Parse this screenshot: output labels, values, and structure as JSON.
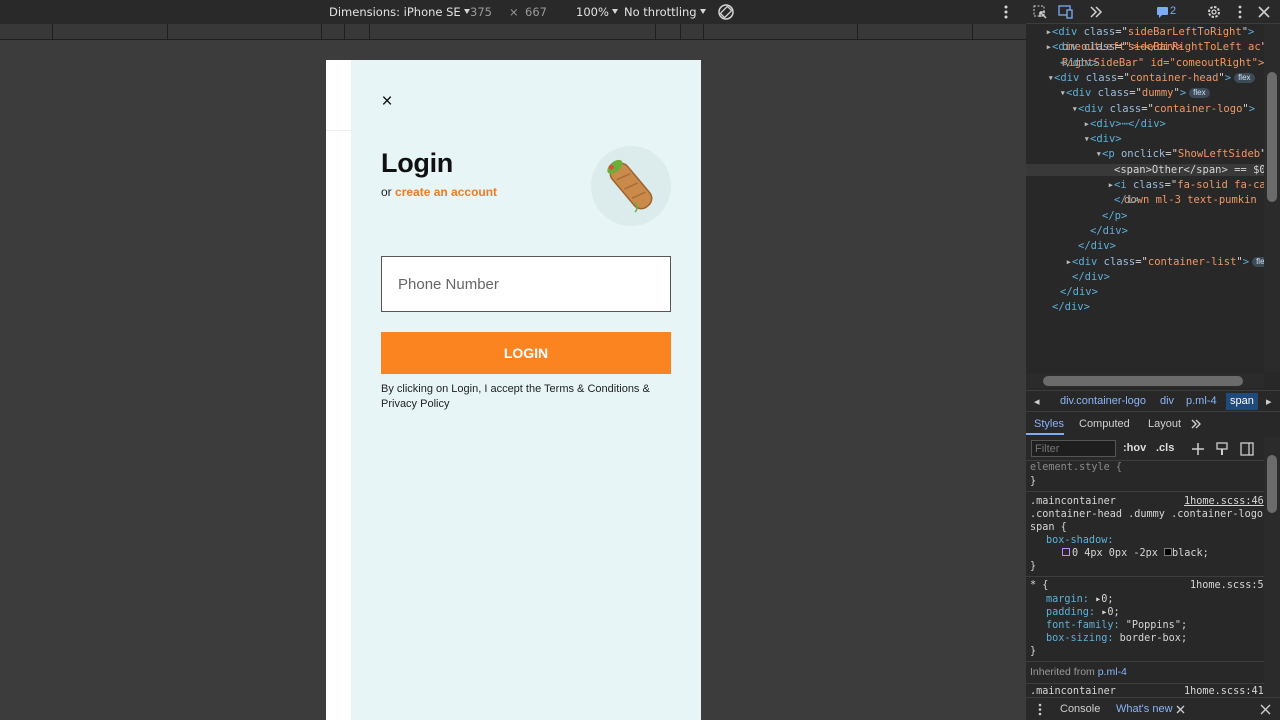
{
  "toolbar": {
    "dimensions_label": "Dimensions: iPhone SE",
    "width": "375",
    "times": "×",
    "height": "667",
    "zoom": "100%",
    "throttling": "No throttling"
  },
  "app": {
    "close_symbol": "×",
    "title": "Login",
    "subtitle_prefix": "or",
    "create_account": "create an account",
    "phone_placeholder": "Phone Number",
    "login_button": "LOGIN",
    "terms": "By clicking on Login, I accept the Terms & Conditions & Privacy Policy",
    "avatar_icon": "food-wrap-icon"
  },
  "devtools": {
    "issues_count": "2",
    "dom_lines": [
      {
        "tag": "div",
        "attr": "class",
        "val": "sideBarLeftToRight",
        "extra": "omeoutLeft\">⋯</div>"
      },
      {
        "tag": "div",
        "attr": "class",
        "val": "sideBarRightToLeft ac",
        "extra": "RightSideBar\" id=\"comeoutRight\">"
      },
      {
        "text": "</div>"
      },
      {
        "tag": "div",
        "attr": "class",
        "val": "container-head",
        "pill": "flex"
      },
      {
        "tag": "div",
        "attr": "class",
        "val": "dummy",
        "pill": "flex"
      },
      {
        "tag": "div",
        "attr": "class",
        "val": "container-logo"
      },
      {
        "text": "<div>⋯</div>"
      },
      {
        "text": "<div>"
      },
      {
        "tag": "p",
        "attr": "onclick",
        "val": "ShowLeftSideb",
        "extra": "\" class=\"ml-4\">"
      },
      {
        "text": "<span>Other</span> == $0"
      },
      {
        "tag": "i",
        "attr": "class",
        "val": "fa-solid fa-ca",
        "extra": "down ml-3 text-pumkin \">"
      },
      {
        "text": "</i>"
      },
      {
        "text": "</p>"
      },
      {
        "text": "</div>"
      },
      {
        "text": "</div>"
      },
      {
        "tag": "div",
        "attr": "class",
        "val": "container-list",
        "pill": "flex"
      },
      {
        "text": "</div>"
      },
      {
        "text": "</div>"
      },
      {
        "text": "</div>"
      }
    ],
    "breadcrumbs": [
      "div.container-logo",
      "div",
      "p.ml-4",
      "span"
    ],
    "tabs": [
      "Styles",
      "Computed",
      "Layout"
    ],
    "filter_placeholder": "Filter",
    "hov": ":hov",
    "cls": ".cls",
    "styles": {
      "element_style": "element.style {",
      "close_brace": "}",
      "rule1_selector_1": ".maincontainer",
      "rule1_source": "1home.scss:46",
      "rule1_selector_2": ".container-head .dummy .container-logo",
      "rule1_selector_3": "span {",
      "rule1_prop": "box-shadow:",
      "rule1_value": "0 4px 0px -2px",
      "rule1_color": "black;",
      "rule2_selector": "* {",
      "rule2_source": "1home.scss:5",
      "rule2_props": [
        {
          "name": "margin:",
          "value": "0;"
        },
        {
          "name": "padding:",
          "value": "0;"
        },
        {
          "name": "font-family:",
          "value": "\"Poppins\";"
        },
        {
          "name": "box-sizing:",
          "value": "border-box;"
        }
      ],
      "inherited_label": "Inherited from",
      "inherited_from": "p.ml-4",
      "rule3_selector": ".maincontainer",
      "rule3_source": "1home.scss:41"
    },
    "drawer_tabs": [
      "Console",
      "What's new"
    ]
  }
}
